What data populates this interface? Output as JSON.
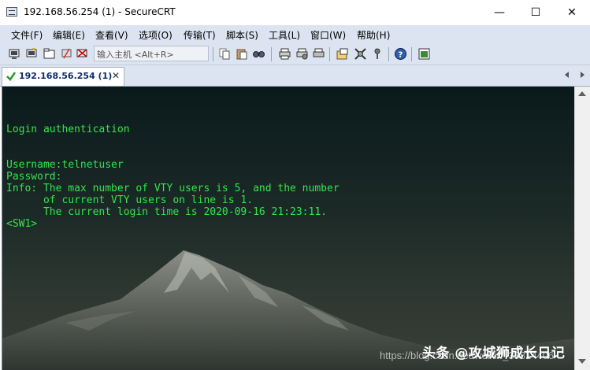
{
  "window": {
    "title": "192.168.56.254 (1) - SecureCRT",
    "minimize_glyph": "—",
    "maximize_glyph": "☐",
    "close_glyph": "✕"
  },
  "menu": {
    "items": [
      {
        "label": "文件(F)"
      },
      {
        "label": "编辑(E)"
      },
      {
        "label": "查看(V)"
      },
      {
        "label": "选项(O)"
      },
      {
        "label": "传输(T)"
      },
      {
        "label": "脚本(S)"
      },
      {
        "label": "工具(L)"
      },
      {
        "label": "窗口(W)"
      },
      {
        "label": "帮助(H)"
      }
    ]
  },
  "toolbar": {
    "host_placeholder": "输入主机 <Alt+R>",
    "icons": [
      "connect-icon",
      "quick-connect-icon",
      "connect-in-tab-icon",
      "reconnect-icon",
      "disconnect-icon",
      "copy-icon",
      "paste-icon",
      "find-icon",
      "print-icon",
      "print-setup-icon",
      "print-selection-icon",
      "session-options-icon",
      "global-options-icon",
      "key-icon",
      "help-icon",
      "script-icon"
    ]
  },
  "tabs": [
    {
      "label": "192.168.56.254 (1)",
      "close_glyph": "✕",
      "status_icon": "check-icon",
      "status_color": "#2a9b2a"
    }
  ],
  "terminal": {
    "text_color": "#2ee64b",
    "lines": [
      "",
      "Login authentication",
      "",
      "",
      "Username:telnetuser",
      "Password:",
      "Info: The max number of VTY users is 5, and the number",
      "      of current VTY users on line is 1.",
      "      The current login time is 2020-09-16 21:23:11.",
      "<SW1>"
    ]
  },
  "watermark": {
    "logo_text": "头条 @攻城狮成长日记",
    "url_text": "https://blog.csdn.net/weixin_38814406"
  }
}
